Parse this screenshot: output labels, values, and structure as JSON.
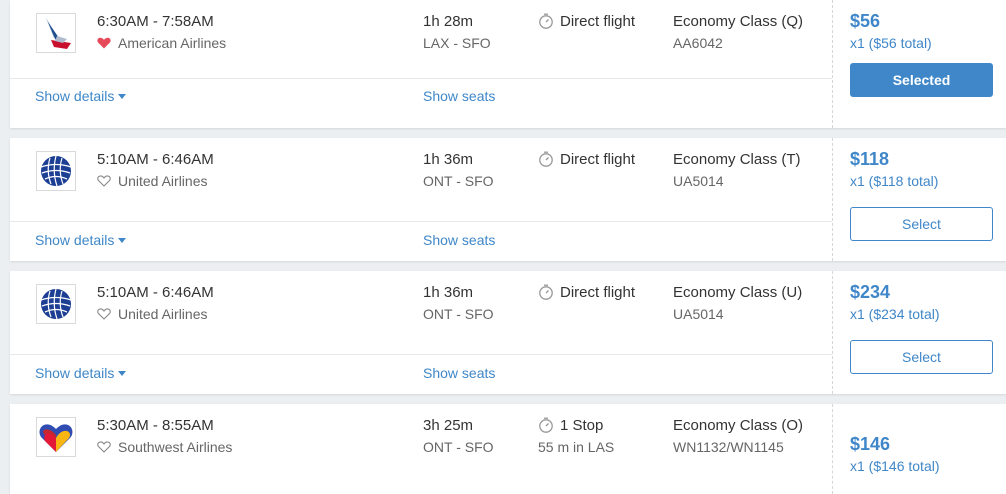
{
  "flights": [
    {
      "times": "6:30AM - 7:58AM",
      "airline": "American Airlines",
      "favorited": true,
      "logo_icon": "american-airlines-logo",
      "duration": "1h 28m",
      "route": "LAX - SFO",
      "stops": "Direct flight",
      "stops_detail": "",
      "cabin_class": "Economy Class (Q)",
      "flight_number": "AA6042",
      "price": "$56",
      "price_total": "x1 ($56 total)",
      "button_label": "Selected",
      "button_state": "selected",
      "details_label": "Show details",
      "seats_label": "Show seats"
    },
    {
      "times": "5:10AM - 6:46AM",
      "airline": "United Airlines",
      "favorited": false,
      "logo_icon": "united-airlines-globe-logo",
      "duration": "1h 36m",
      "route": "ONT - SFO",
      "stops": "Direct flight",
      "stops_detail": "",
      "cabin_class": "Economy Class (T)",
      "flight_number": "UA5014",
      "price": "$118",
      "price_total": "x1 ($118 total)",
      "button_label": "Select",
      "button_state": "select",
      "details_label": "Show details",
      "seats_label": "Show seats"
    },
    {
      "times": "5:10AM - 6:46AM",
      "airline": "United Airlines",
      "favorited": false,
      "logo_icon": "united-airlines-globe-logo",
      "duration": "1h 36m",
      "route": "ONT - SFO",
      "stops": "Direct flight",
      "stops_detail": "",
      "cabin_class": "Economy Class (U)",
      "flight_number": "UA5014",
      "price": "$234",
      "price_total": "x1 ($234 total)",
      "button_label": "Select",
      "button_state": "select",
      "details_label": "Show details",
      "seats_label": "Show seats"
    },
    {
      "times": "5:30AM - 8:55AM",
      "airline": "Southwest Airlines",
      "favorited": false,
      "logo_icon": "southwest-heart-logo",
      "duration": "3h 25m",
      "route": "ONT - SFO",
      "stops": "1 Stop",
      "stops_detail": "55 m in LAS",
      "cabin_class": "Economy Class (O)",
      "flight_number": "WN1132/WN1145",
      "price": "$146",
      "price_total": "x1 ($146 total)"
    }
  ],
  "colors": {
    "accent": "#3f87c8",
    "favorite_heart": "#e5495a",
    "background": "#eceff2"
  }
}
